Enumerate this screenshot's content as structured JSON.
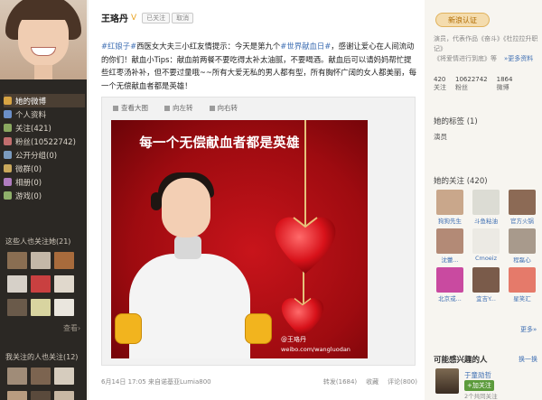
{
  "profile": {
    "name": "王珞丹",
    "verified_mark": "V",
    "follow_status": "已关注",
    "cancel_label": "取消"
  },
  "left_nav": {
    "items": [
      {
        "label": "她的微博",
        "color": "#d8a443"
      },
      {
        "label": "个人资料",
        "color": "#6b8fc8"
      },
      {
        "label": "关注(421)",
        "color": "#8aa860"
      },
      {
        "label": "粉丝(10522742)",
        "color": "#c26e6e"
      },
      {
        "label": "公开分组(0)",
        "color": "#7b9bbf"
      },
      {
        "label": "微群(0)",
        "color": "#c9a85b"
      },
      {
        "label": "相册(0)",
        "color": "#b07cbf"
      },
      {
        "label": "游戏(0)",
        "color": "#8fb06a"
      }
    ],
    "followers_title": "这些人也关注她(21)",
    "more_label": "查看›",
    "mutual_title": "我关注的人也关注(12)"
  },
  "post": {
    "text_parts": [
      {
        "t": "#红娘子#",
        "hl": true
      },
      {
        "t": "西医女大夫三小红友情提示：今天是第九个",
        "hl": false
      },
      {
        "t": "#世界献血日#",
        "hl": true
      },
      {
        "t": "，感谢让爱心在人间流动的你们！献血",
        "hl": false
      },
      {
        "t": "小Tips：献血前两餐不要吃得太补太油腻，不要喝酒。献血后可以请妈妈帮忙提些红枣汤补补，但不要过量哦~~所有大爱无私的男人都有型，所有胸怀广阔的女人都美丽，每一个无偿献血者都是英雄！",
        "hl": false
      }
    ],
    "media_bar": {
      "view_large": "查看大图",
      "rotate_left": "向左转",
      "rotate_right": "向右转"
    },
    "poster_title": "每一个无偿献血者都是英雄",
    "watermark": "@王珞丹",
    "watermark_url": "weibo.com/wangluodan",
    "timestamp": "6月14日 17:05 来自诺基亚Lumia800",
    "actions": {
      "share": "转发(1684)",
      "favorite": "收藏",
      "comment": "评论(800)"
    }
  },
  "right": {
    "verify_btn": "新浪认证",
    "info_lines": [
      "演员，代表作品《奋斗》《杜拉拉升职记》",
      "《将爱情进行到底》等"
    ],
    "more_info": "»更多资料",
    "stats": [
      {
        "value": "420",
        "label": "关注"
      },
      {
        "value": "10622742",
        "label": "粉丝"
      },
      {
        "value": "1864",
        "label": "微博"
      }
    ],
    "tags_title": "她的标签 (1)",
    "tag": "演员",
    "follows_title": "她的关注 (420)",
    "follows": [
      {
        "label": "狗狗先生",
        "color": "#c9a78b"
      },
      {
        "label": "斗鱼粘油",
        "color": "#dcdcd4"
      },
      {
        "label": "官方火锅",
        "color": "#8c6a55"
      },
      {
        "label": "沈蕾...",
        "color": "#b38a76"
      },
      {
        "label": "Cmoeiz",
        "color": "#eceae4"
      },
      {
        "label": "程磊心",
        "color": "#a89a8c"
      },
      {
        "label": "北京或...",
        "color": "#c94aa0"
      },
      {
        "label": "宜吉Y...",
        "color": "#7a5b4a"
      },
      {
        "label": "星笑汇",
        "color": "#e57a6a"
      }
    ],
    "more_link": "更多»",
    "suggest_title": "可能感兴趣的人",
    "swap_label": "换一换",
    "suggest_name": "于童勋哲",
    "suggest_add": "+加关注",
    "suggest_extra": "2个共同关注"
  }
}
